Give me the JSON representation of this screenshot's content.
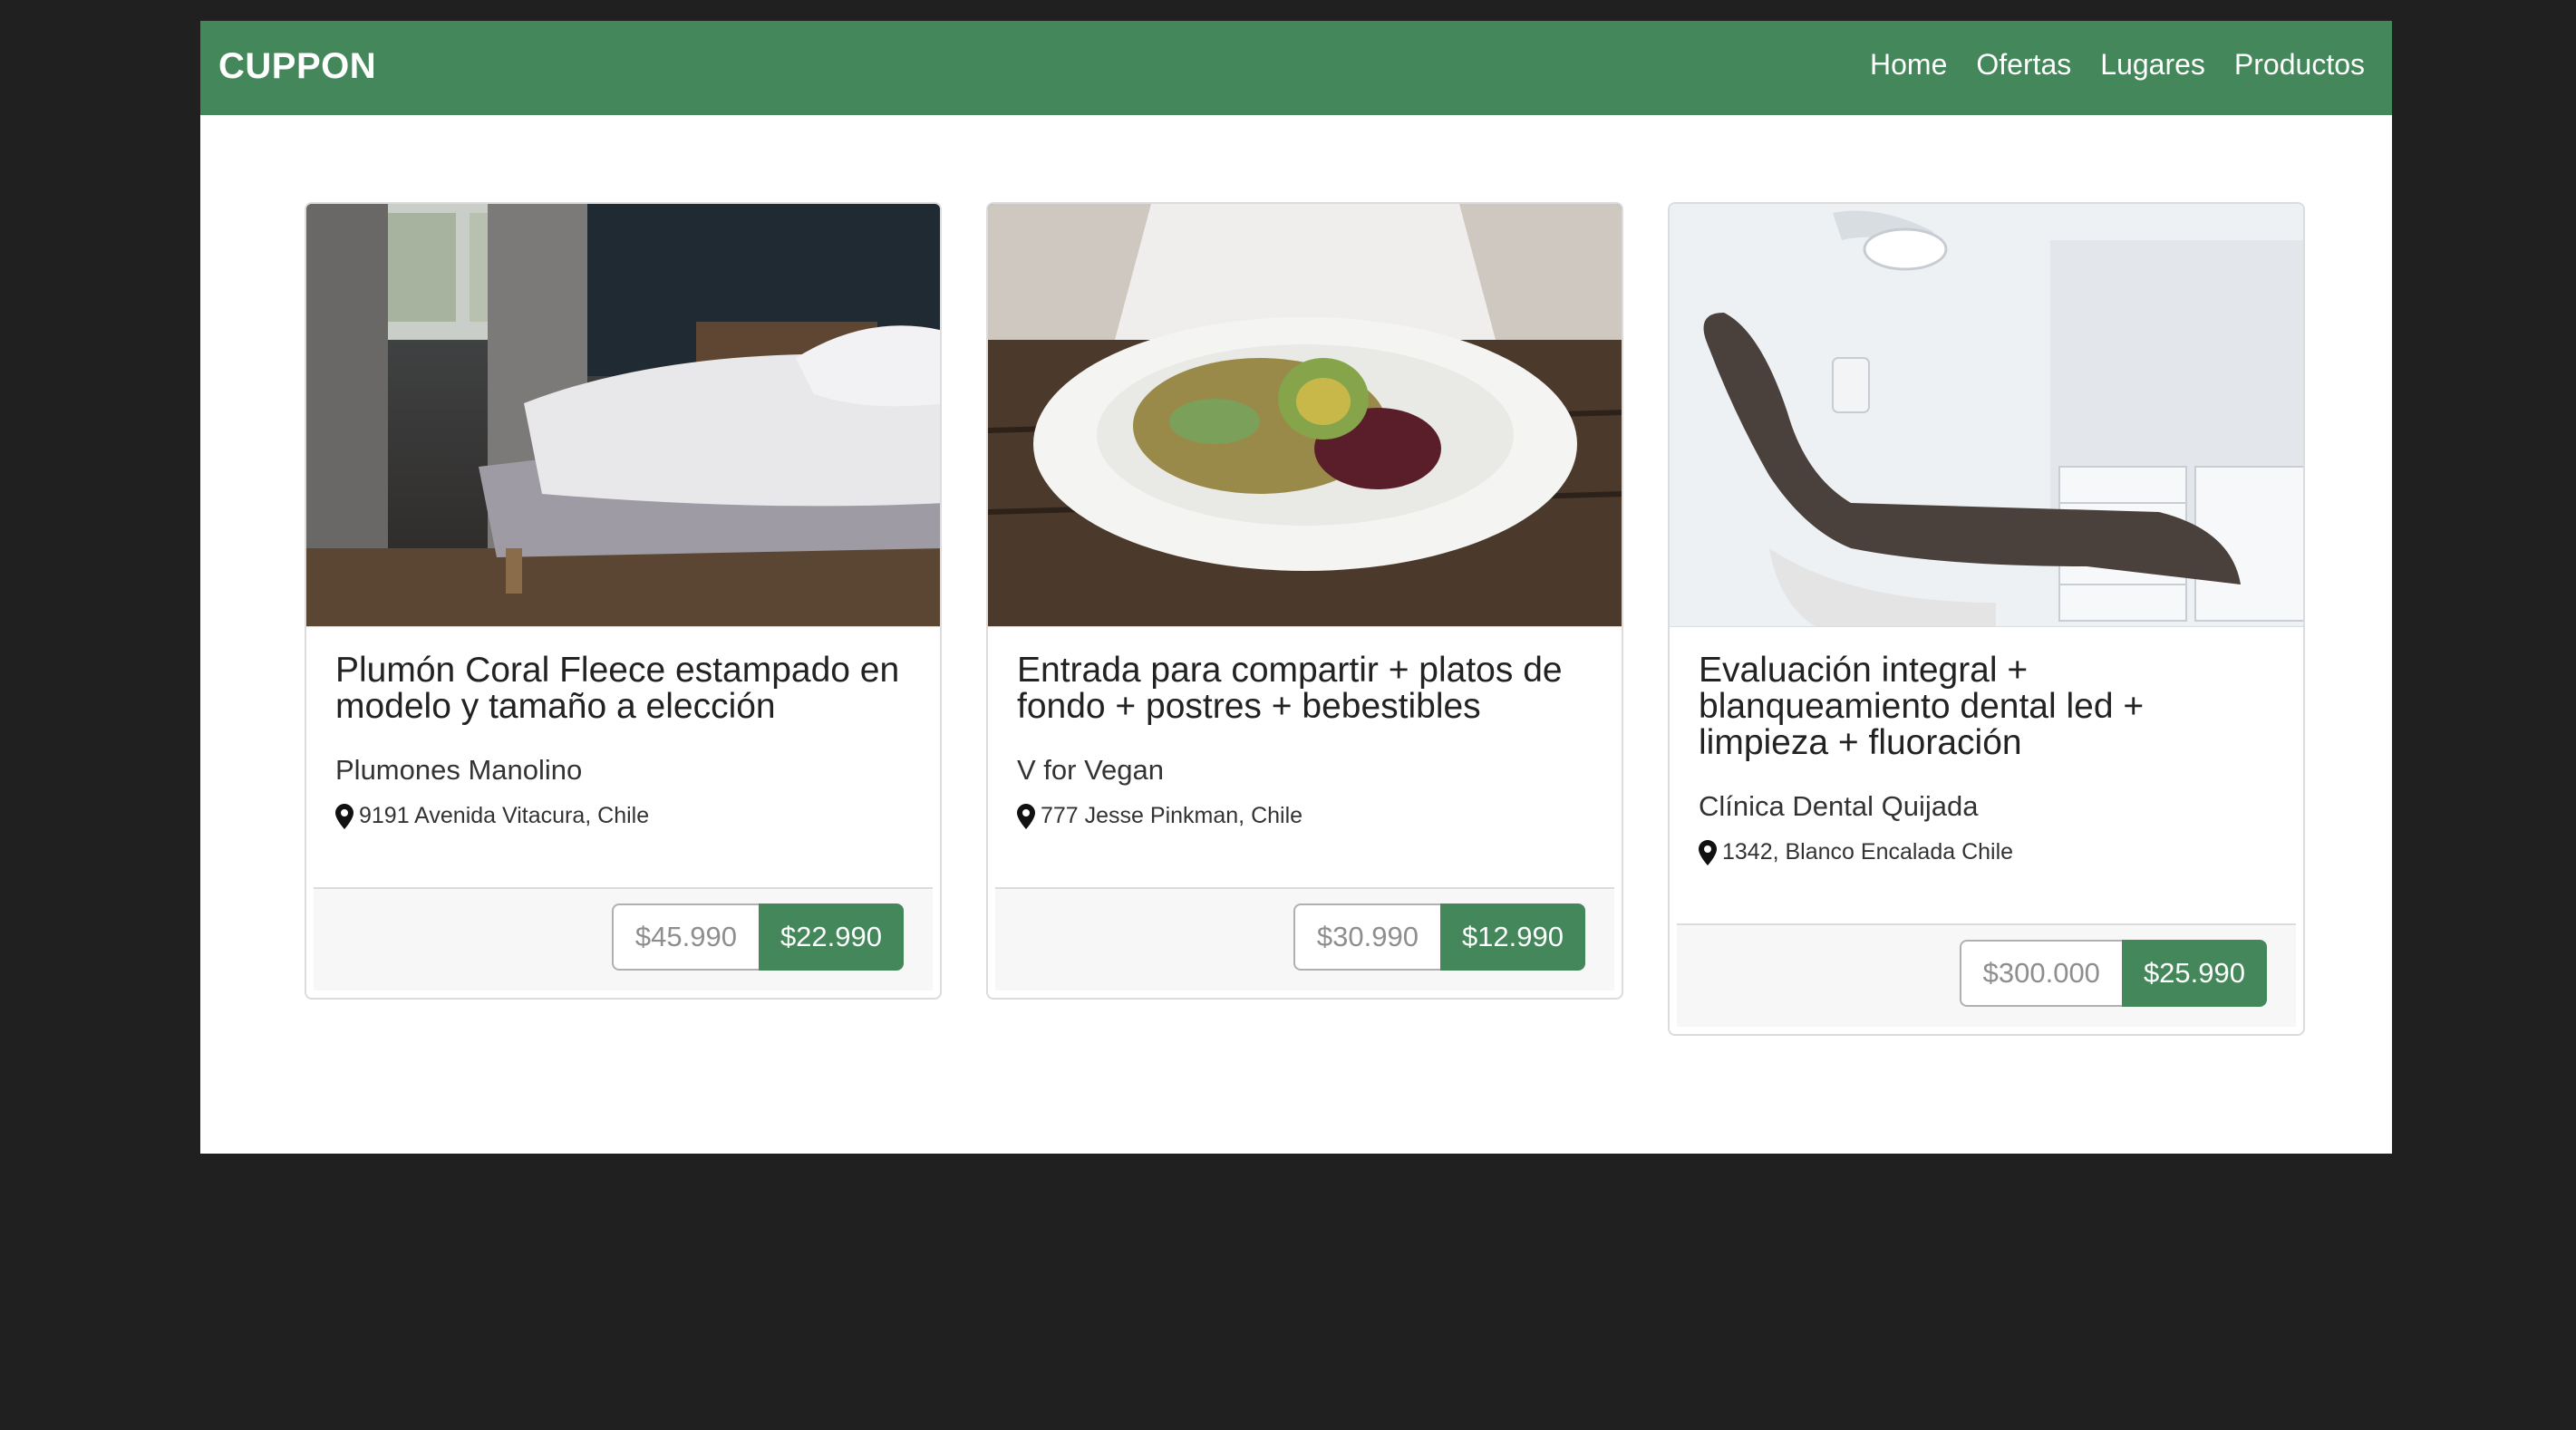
{
  "navbar": {
    "brand": "CUPPON",
    "links": [
      "Home",
      "Ofertas",
      "Lugares",
      "Productos"
    ],
    "color": "#43875a"
  },
  "cards": [
    {
      "image": "bedroom-bed-photo",
      "title": "Plumón Coral Fleece estampado en modelo y tamaño a elección",
      "vendor": "Plumones Manolino",
      "address": "9191 Avenida Vitacura, Chile",
      "old_price": "$45.990",
      "new_price": "$22.990"
    },
    {
      "image": "vegan-salad-plate-photo",
      "title": "Entrada para compartir + platos de fondo + postres + bebestibles",
      "vendor": "V for Vegan",
      "address": "777 Jesse Pinkman, Chile",
      "old_price": "$30.990",
      "new_price": "$12.990"
    },
    {
      "image": "dental-chair-photo",
      "title": "Evaluación integral + blanqueamiento dental led + limpieza + fluoración",
      "vendor": "Clínica Dental Quijada",
      "address": "1342, Blanco Encalada Chile",
      "old_price": "$300.000",
      "new_price": "$25.990"
    }
  ]
}
